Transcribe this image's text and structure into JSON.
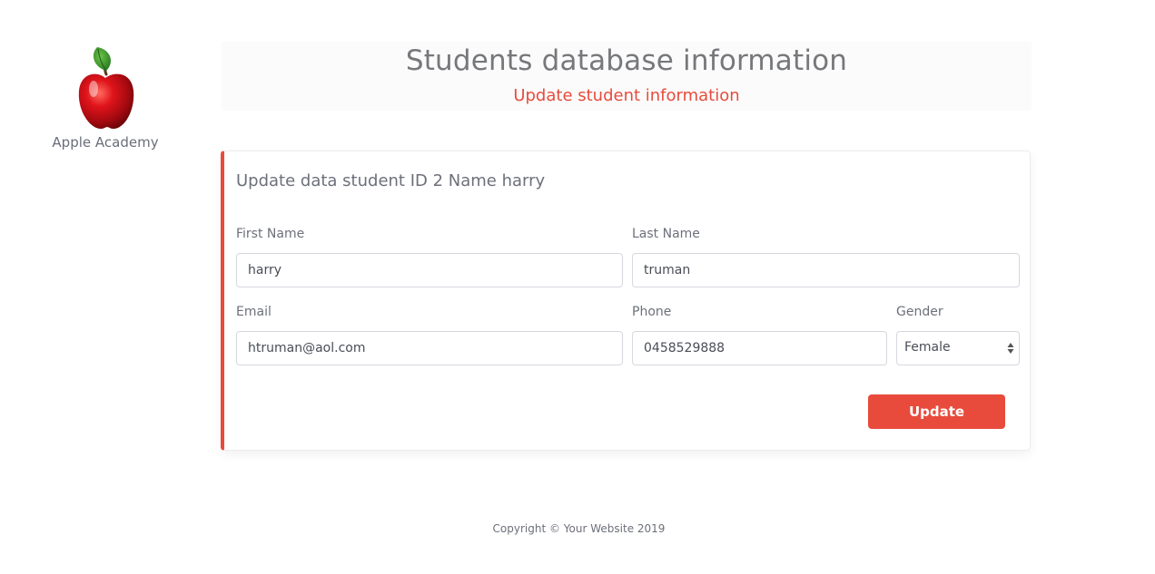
{
  "logo": {
    "text": "Apple Academy",
    "icon": "apple-icon"
  },
  "header": {
    "title": "Students database information",
    "subtitle": "Update student information"
  },
  "form": {
    "title": "Update data student ID 2 Name harry",
    "first_name": {
      "label": "First Name",
      "value": "harry"
    },
    "last_name": {
      "label": "Last Name",
      "value": "truman"
    },
    "email": {
      "label": "Email",
      "value": "htruman@aol.com"
    },
    "phone": {
      "label": "Phone",
      "value": "0458529888"
    },
    "gender": {
      "label": "Gender",
      "value": "Female"
    },
    "submit_label": "Update"
  },
  "footer": {
    "text": "Copyright © Your Website 2019"
  },
  "colors": {
    "accent": "#e84b3c",
    "text_muted": "#6d707a",
    "title": "#77787b"
  }
}
